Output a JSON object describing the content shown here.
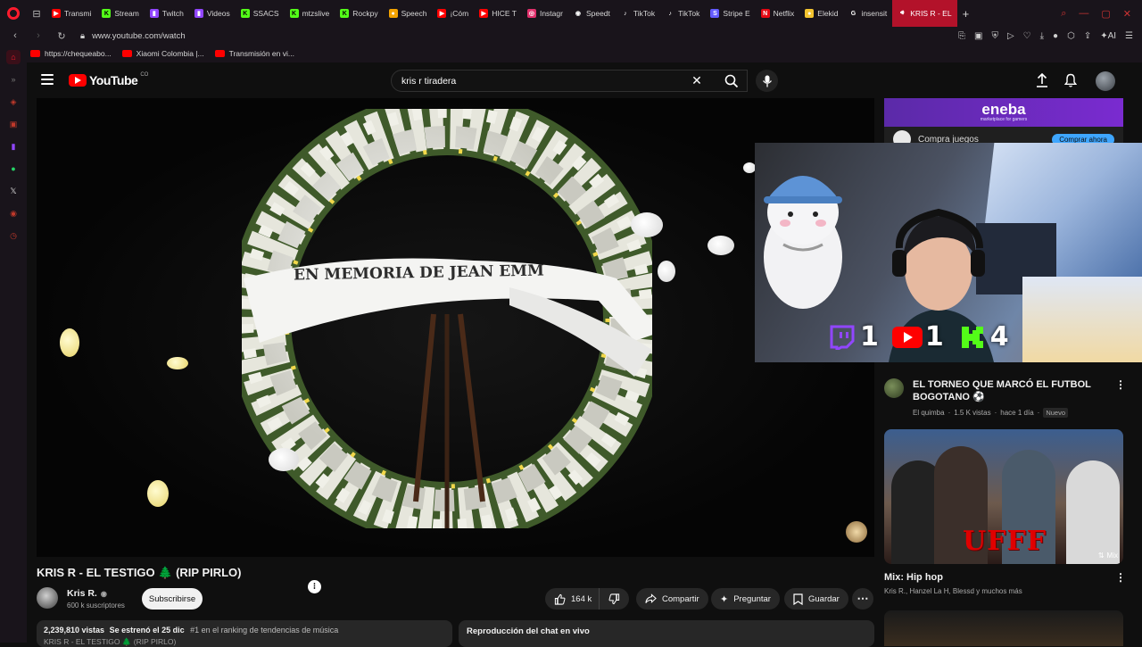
{
  "browser": {
    "tabs": [
      {
        "label": "Transmi",
        "icon": "youtube-icon",
        "color": "#ff0000"
      },
      {
        "label": "Stream",
        "icon": "kick-icon",
        "color": "#53fc18"
      },
      {
        "label": "Twitch",
        "icon": "twitch-icon",
        "color": "#9146ff"
      },
      {
        "label": "Videos",
        "icon": "twitch-icon",
        "color": "#9146ff"
      },
      {
        "label": "SSACS",
        "icon": "kick-icon",
        "color": "#53fc18"
      },
      {
        "label": "mtzslive",
        "icon": "kick-icon",
        "color": "#53fc18"
      },
      {
        "label": "Rockpy",
        "icon": "kick-icon",
        "color": "#53fc18"
      },
      {
        "label": "Speech",
        "icon": "speech-icon",
        "color": "#f4a300"
      },
      {
        "label": "¡Cóm",
        "icon": "youtube-icon",
        "color": "#ff0000"
      },
      {
        "label": "HICE T",
        "icon": "youtube-icon",
        "color": "#ff0000"
      },
      {
        "label": "Instagr",
        "icon": "instagram-icon",
        "color": "#e1306c"
      },
      {
        "label": "Speedt",
        "icon": "github-icon",
        "color": "#ffffff"
      },
      {
        "label": "TikTok",
        "icon": "tiktok-icon",
        "color": "#ffffff"
      },
      {
        "label": "TikTok",
        "icon": "tiktok-icon",
        "color": "#ffffff"
      },
      {
        "label": "Stripe E",
        "icon": "stripe-icon",
        "color": "#635bff"
      },
      {
        "label": "Netflix",
        "icon": "netflix-icon",
        "color": "#e50914"
      },
      {
        "label": "Elekid",
        "icon": "elekid-icon",
        "color": "#f4c430"
      },
      {
        "label": "insensit",
        "icon": "google-icon",
        "color": "#ffffff"
      },
      {
        "label": "KRIS R - EL",
        "icon": "audio-icon",
        "color": "#ffffff",
        "active": true
      }
    ],
    "url": "www.youtube.com/watch",
    "bookmarks": [
      {
        "label": "https://chequeabo..."
      },
      {
        "label": "Xiaomi Colombia |..."
      },
      {
        "label": "Transmisión en vi..."
      }
    ]
  },
  "header": {
    "logo_text": "YouTube",
    "country": "CO",
    "search_value": "kris r tiradera"
  },
  "video": {
    "ribbon_text": "EN MEMORIA DE JEAN EMM",
    "title": "KRIS R - EL TESTIGO 🌲 (RIP PIRLO)",
    "channel": "Kris R.",
    "subscribers": "600 k suscriptores",
    "subscribe_label": "Subscribirse",
    "likes": "164 k",
    "share_label": "Compartir",
    "ask_label": "Preguntar",
    "save_label": "Guardar",
    "views": "2,239,810 vistas",
    "premiered": "Se estrenó el 25 dic",
    "rank": "#1 en el ranking de tendencias de música",
    "desc_line2": "KRIS R - EL TESTIGO 🌲 (RIP PIRLO)",
    "chat_label": "Reproducción del chat en vivo"
  },
  "overlay": {
    "counts": [
      {
        "platform": "twitch-icon",
        "value": "1",
        "color": "#9146ff"
      },
      {
        "platform": "youtube-icon",
        "value": "1",
        "color": "#ff0000"
      },
      {
        "platform": "kick-icon",
        "value": "4",
        "color": "#53fc18"
      }
    ]
  },
  "sidebar": {
    "ad": {
      "brand": "eneba",
      "tagline": "marketplace for gamers",
      "text": "Compra juegos",
      "cta": "Comprar ahora"
    },
    "recs": [
      {
        "title": "EL TORNEO QUE MARCÓ EL FUTBOL BOGOTANO ⚽",
        "channel": "El quimba",
        "views": "1.5 K vistas",
        "age": "hace 1 día",
        "badge": "Nuevo"
      }
    ],
    "mix": {
      "title": "Mix: Hip hop",
      "subtitle": "Kris R., Hanzel La H, Blessd y muchos más",
      "chip": "Mix",
      "thumb_text": "UFFF"
    }
  }
}
